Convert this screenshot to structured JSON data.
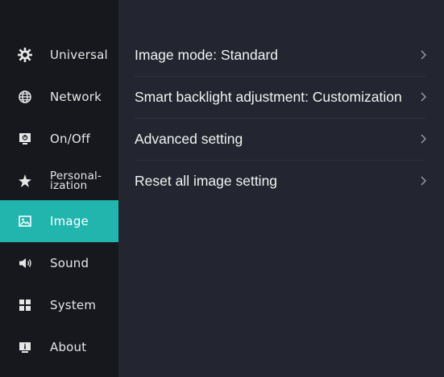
{
  "sidebar": {
    "items": [
      {
        "label": "Universal",
        "icon": "gear-icon",
        "active": false
      },
      {
        "label": "Network",
        "icon": "globe-icon",
        "active": false
      },
      {
        "label": "On/Off",
        "icon": "power-display-icon",
        "active": false
      },
      {
        "label": "Personal-\nization",
        "icon": "sparkle-icon",
        "active": false
      },
      {
        "label": "Image",
        "icon": "image-icon",
        "active": true
      },
      {
        "label": "Sound",
        "icon": "speaker-icon",
        "active": false
      },
      {
        "label": "System",
        "icon": "system-grid-icon",
        "active": false
      },
      {
        "label": "About",
        "icon": "info-monitor-icon",
        "active": false
      }
    ]
  },
  "content": {
    "rows": [
      {
        "label": "Image mode: Standard"
      },
      {
        "label": "Smart backlight adjustment:  Customization"
      },
      {
        "label": "Advanced setting"
      },
      {
        "label": "Reset all image setting"
      }
    ]
  },
  "colors": {
    "sidebar_bg": "#16181e",
    "content_bg": "#232630",
    "accent": "#21b5ad"
  }
}
